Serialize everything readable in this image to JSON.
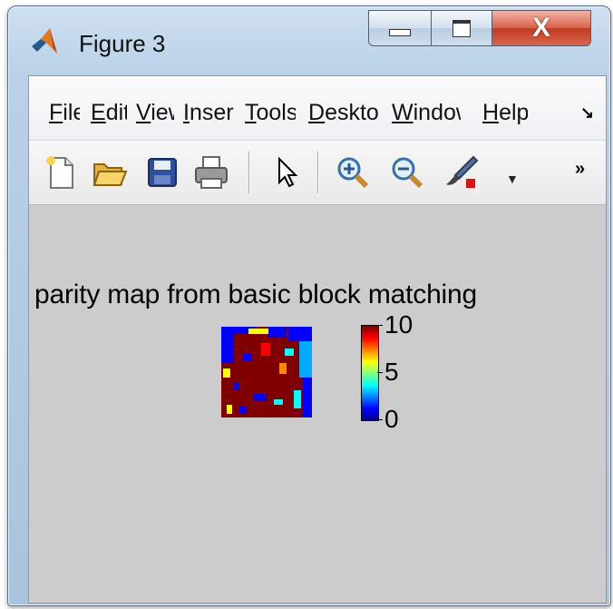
{
  "window": {
    "title": "Figure 3"
  },
  "menu": {
    "items": [
      {
        "underline": "F",
        "rest": "ile"
      },
      {
        "underline": "E",
        "rest": "dit"
      },
      {
        "underline": "V",
        "rest": "iew"
      },
      {
        "underline": "I",
        "rest": "nsert"
      },
      {
        "underline": "T",
        "rest": "ools"
      },
      {
        "underline": "D",
        "rest": "esktop"
      },
      {
        "underline": "W",
        "rest": "indow"
      },
      {
        "underline": "H",
        "rest": "elp"
      }
    ]
  },
  "toolbar": {
    "icons": [
      "new-file-icon",
      "open-folder-icon",
      "save-icon",
      "print-icon",
      "pointer-icon",
      "zoom-in-icon",
      "zoom-out-icon",
      "brush-icon"
    ]
  },
  "figure": {
    "title": "parity map from basic block matching",
    "colorbar": {
      "ticks": [
        "10",
        "5",
        "0"
      ],
      "range": [
        0,
        10
      ]
    }
  },
  "colors": {
    "close_button": "#c8432b",
    "figure_background": "#cccccc",
    "map_dark_red": "#800000",
    "map_blue": "#0000ff"
  }
}
